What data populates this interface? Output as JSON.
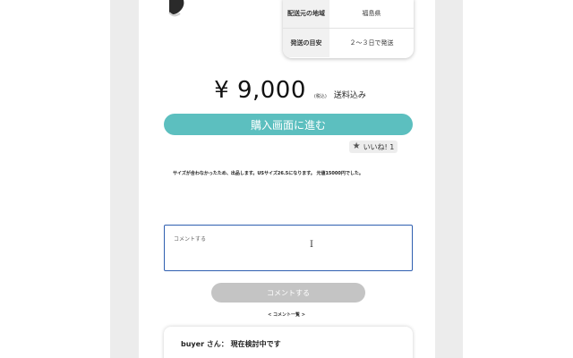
{
  "shipping_info": {
    "rows": [
      {
        "label": "配送元の地域",
        "value": "福島県"
      },
      {
        "label": "発送の目安",
        "value": "２〜３日で発送"
      }
    ]
  },
  "price": {
    "amount": "¥ 9,000",
    "tax_note": "(税込)",
    "shipping_note": "送料込み"
  },
  "buy_button": {
    "label": "購入画面に進む"
  },
  "like_button": {
    "label": "いいね! 1",
    "icon": "star-icon"
  },
  "description": "サイズが合わなかったため、出品します。USサイズ26.5になります。 元値15000円でした。",
  "comment_form": {
    "placeholder": "コメントする",
    "submit_label": "コメントする"
  },
  "comment_list": {
    "heading": "< コメント一覧 >",
    "items": [
      {
        "text": "buyer さん： 現在検討中です"
      }
    ]
  },
  "colors": {
    "accent": "#5cbfbf",
    "input_focus_border": "#2f5fb0",
    "disabled_button": "#c4c4c4"
  }
}
